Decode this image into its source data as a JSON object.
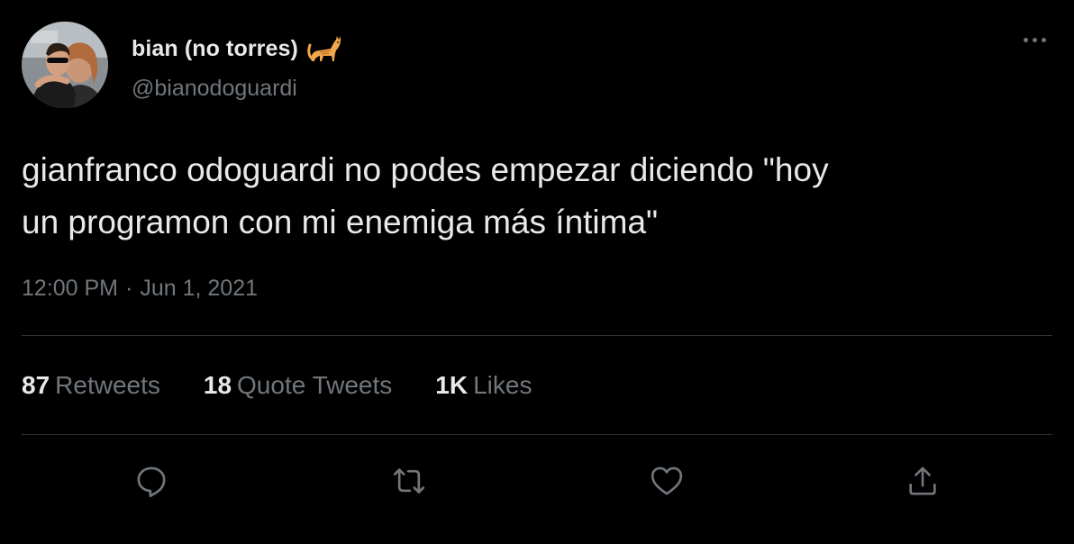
{
  "author": {
    "display_name": "bian (no torres)",
    "name_emoji": "cat-emoji",
    "handle": "@bianodoguardi",
    "avatar": "profile-photo"
  },
  "tweet": {
    "text": "gianfranco odoguardi no podes empezar diciendo \"hoy\nun programon con mi enemiga más íntima\"",
    "time": "12:00 PM",
    "separator": "·",
    "date": "Jun 1, 2021"
  },
  "stats": [
    {
      "count": "87",
      "label": "Retweets"
    },
    {
      "count": "18",
      "label": "Quote Tweets"
    },
    {
      "count": "1K",
      "label": "Likes"
    }
  ],
  "actions": {
    "reply_icon": "reply-icon",
    "retweet_icon": "retweet-icon",
    "like_icon": "heart-icon",
    "share_icon": "share-icon",
    "more_icon": "more-options-icon"
  },
  "colors": {
    "background": "#000000",
    "primary_text": "#e7e9ea",
    "secondary_text": "#71767b",
    "divider": "#2f3336"
  }
}
